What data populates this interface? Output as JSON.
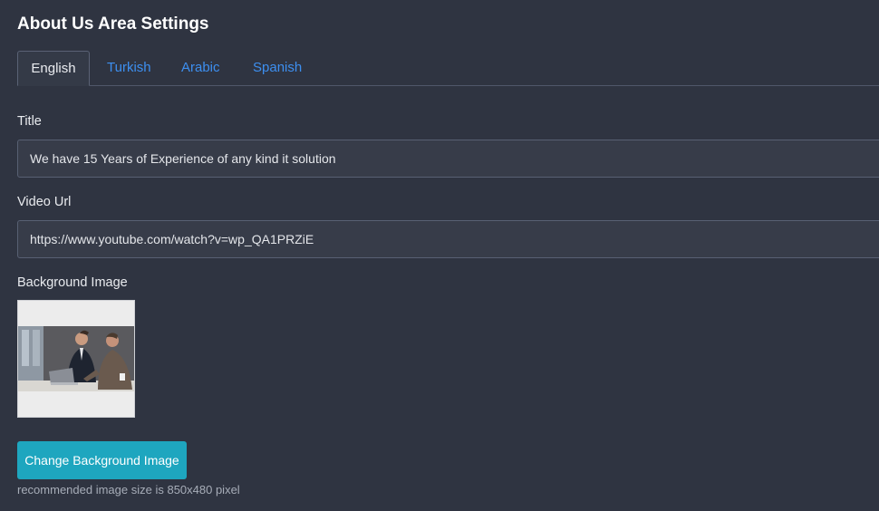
{
  "page": {
    "title": "About Us Area Settings"
  },
  "tabs": [
    {
      "label": "English",
      "active": true
    },
    {
      "label": "Turkish",
      "active": false
    },
    {
      "label": "Arabic",
      "active": false
    },
    {
      "label": "Spanish",
      "active": false
    }
  ],
  "form": {
    "title_label": "Title",
    "title_value": "We have 15 Years of Experience of any kind it solution",
    "video_label": "Video Url",
    "video_value": "https://www.youtube.com/watch?v=wp_QA1PRZiE",
    "background_label": "Background Image",
    "change_button": "Change Background Image",
    "hint": "recommended image size is 850x480 pixel"
  },
  "colors": {
    "background": "#2f3441",
    "accent": "#1ea6bf",
    "tab_link": "#3d8ff0"
  }
}
